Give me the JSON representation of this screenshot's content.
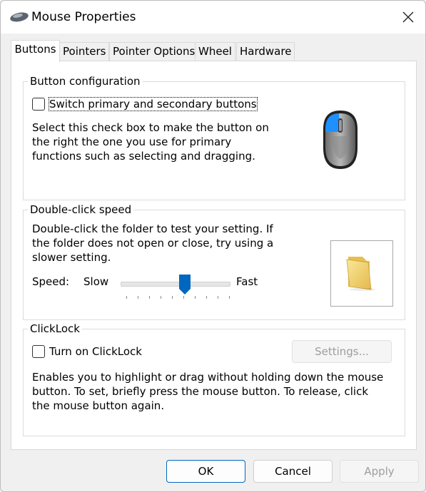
{
  "window": {
    "title": "Mouse Properties"
  },
  "tabs": [
    "Buttons",
    "Pointers",
    "Pointer Options",
    "Wheel",
    "Hardware"
  ],
  "button_config": {
    "legend": "Button configuration",
    "switch_label": "Switch primary and secondary buttons",
    "switch_checked": false,
    "description": "Select this check box to make the button on the right the one you use for primary functions such as selecting and dragging."
  },
  "double_click": {
    "legend": "Double-click speed",
    "description": "Double-click the folder to test your setting. If the folder does not open or close, try using a slower setting.",
    "speed_label": "Speed:",
    "slow_label": "Slow",
    "fast_label": "Fast",
    "speed_value": 0.6
  },
  "clicklock": {
    "legend": "ClickLock",
    "turn_on_label": "Turn on ClickLock",
    "turn_on_checked": false,
    "settings_label": "Settings...",
    "description": "Enables you to highlight or drag without holding down the mouse button. To set, briefly press the mouse button. To release, click the mouse button again."
  },
  "footer": {
    "ok_label": "OK",
    "cancel_label": "Cancel",
    "apply_label": "Apply"
  },
  "colors": {
    "accent": "#0067c0",
    "mouse_button_highlight": "#1e90ff"
  }
}
